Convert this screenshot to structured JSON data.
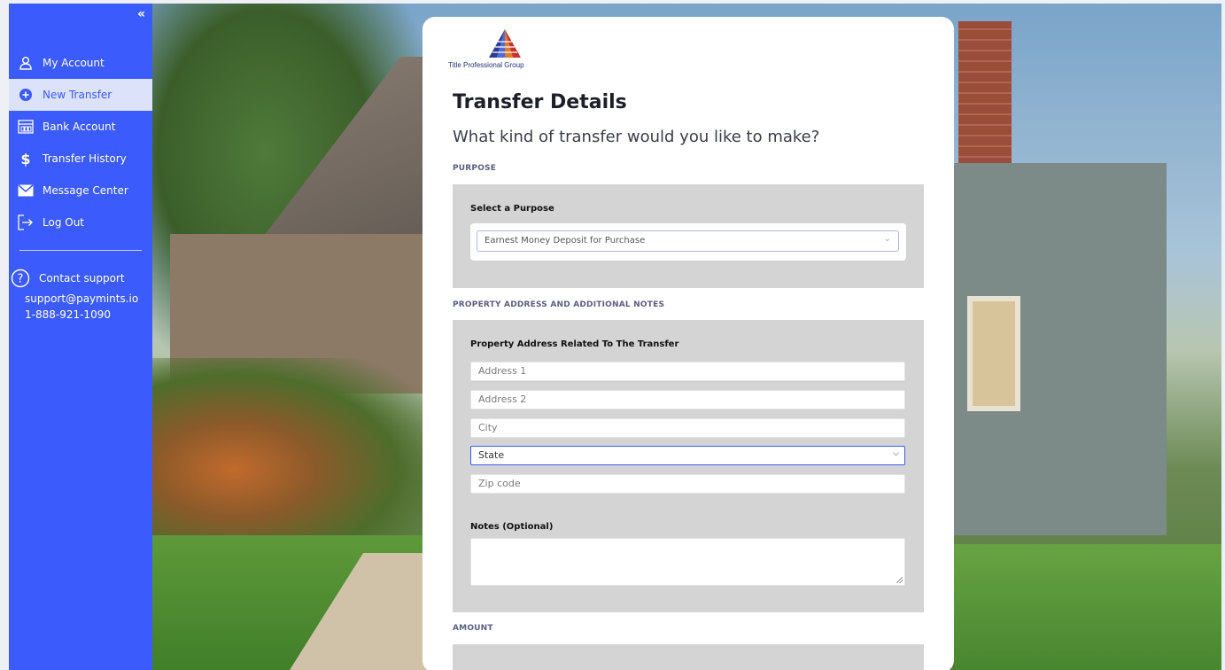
{
  "sidebar": {
    "collapse_icon": "double-chevron-left",
    "items": [
      {
        "label": "My Account",
        "icon": "user-icon",
        "active": false
      },
      {
        "label": "New Transfer",
        "icon": "plus-circle-icon",
        "active": true
      },
      {
        "label": "Bank Account",
        "icon": "bank-icon",
        "active": false
      },
      {
        "label": "Transfer History",
        "icon": "dollar-icon",
        "active": false
      },
      {
        "label": "Message Center",
        "icon": "mail-icon",
        "active": false
      },
      {
        "label": "Log Out",
        "icon": "logout-icon",
        "active": false
      }
    ],
    "support": {
      "label": "Contact support",
      "email": "support@paymints.io",
      "phone": "1-888-921-1090"
    }
  },
  "card": {
    "logo_text": "Title Professional Group",
    "title": "Transfer Details",
    "subtitle": "What kind of transfer would you like to make?",
    "purpose_section": "PURPOSE",
    "select_purpose_label": "Select a Purpose",
    "purpose_value": "Earnest Money Deposit for Purchase",
    "address_section": "PROPERTY ADDRESS AND ADDITIONAL NOTES",
    "address_label": "Property Address Related To The Transfer",
    "address1_placeholder": "Address 1",
    "address2_placeholder": "Address 2",
    "city_placeholder": "City",
    "state_value": "State",
    "zip_placeholder": "Zip code",
    "notes_label": "Notes (Optional)",
    "amount_section": "AMOUNT"
  },
  "colors": {
    "sidebar": "#3b5bfd",
    "active_item_bg": "#dbe2fa",
    "panel_bg": "#d4d4d4"
  }
}
